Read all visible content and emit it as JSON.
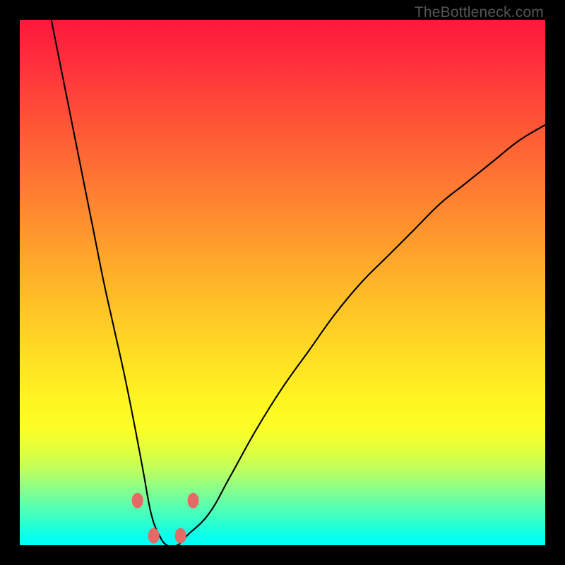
{
  "attribution": "TheBottleneck.com",
  "chart_data": {
    "type": "line",
    "title": "",
    "xlabel": "",
    "ylabel": "",
    "xlim": [
      0,
      100
    ],
    "ylim": [
      0,
      100
    ],
    "grid": false,
    "legend": false,
    "annotations": [],
    "series": [
      {
        "name": "bottleneck-curve",
        "color": "#000000",
        "x": [
          6,
          8,
          10,
          12,
          14,
          16,
          18,
          20,
          22,
          23.5,
          25,
          26.5,
          28,
          30,
          32,
          36,
          40,
          45,
          50,
          55,
          60,
          65,
          70,
          75,
          80,
          85,
          90,
          95,
          100
        ],
        "y": [
          100,
          90,
          80,
          70,
          60,
          50,
          41,
          32,
          22,
          14,
          6,
          2,
          0,
          0,
          2,
          6,
          13,
          22,
          30,
          37,
          44,
          50,
          55,
          60,
          65,
          69,
          73,
          77,
          80
        ]
      }
    ],
    "markers": [
      {
        "name": "marker-left-upper",
        "x": 22.4,
        "y": 8.5
      },
      {
        "name": "marker-left-lower",
        "x": 25.5,
        "y": 1.8
      },
      {
        "name": "marker-right-lower",
        "x": 30.6,
        "y": 1.8
      },
      {
        "name": "marker-right-upper",
        "x": 33.0,
        "y": 8.5
      }
    ],
    "marker_color": "#e46a66",
    "background_gradient": {
      "direction": "top-to-bottom",
      "stops": [
        {
          "pos": 0,
          "color": "#ff183b"
        },
        {
          "pos": 50,
          "color": "#ffb828"
        },
        {
          "pos": 75,
          "color": "#fff922"
        },
        {
          "pos": 100,
          "color": "#00fff7"
        }
      ]
    }
  }
}
